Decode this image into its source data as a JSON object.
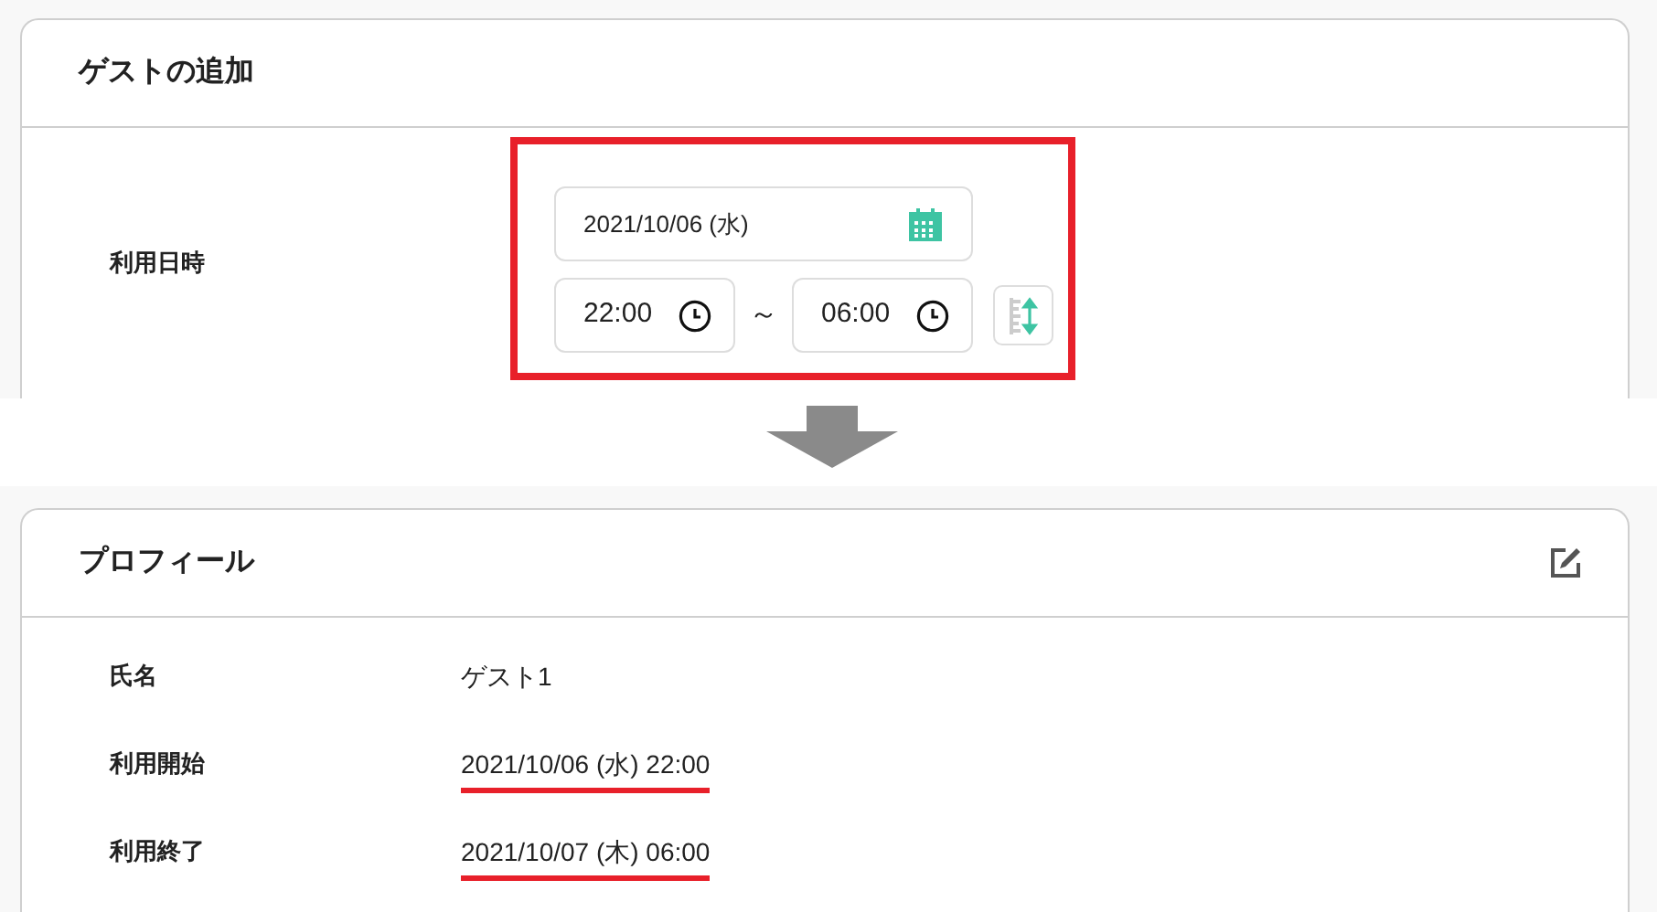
{
  "guest_form": {
    "title": "ゲストの追加",
    "label": "利用日時",
    "highlighted": true,
    "date": "2021/10/06 (水)",
    "start_time": "22:00",
    "separator": "～",
    "end_time": "06:00"
  },
  "profile": {
    "title": "プロフィール",
    "rows": [
      {
        "label": "氏名",
        "value": "ゲスト1",
        "underlined": false
      },
      {
        "label": "利用開始",
        "value": "2021/10/06 (水) 22:00",
        "underlined": true
      },
      {
        "label": "利用終了",
        "value": "2021/10/07 (木) 06:00",
        "underlined": true
      }
    ]
  }
}
